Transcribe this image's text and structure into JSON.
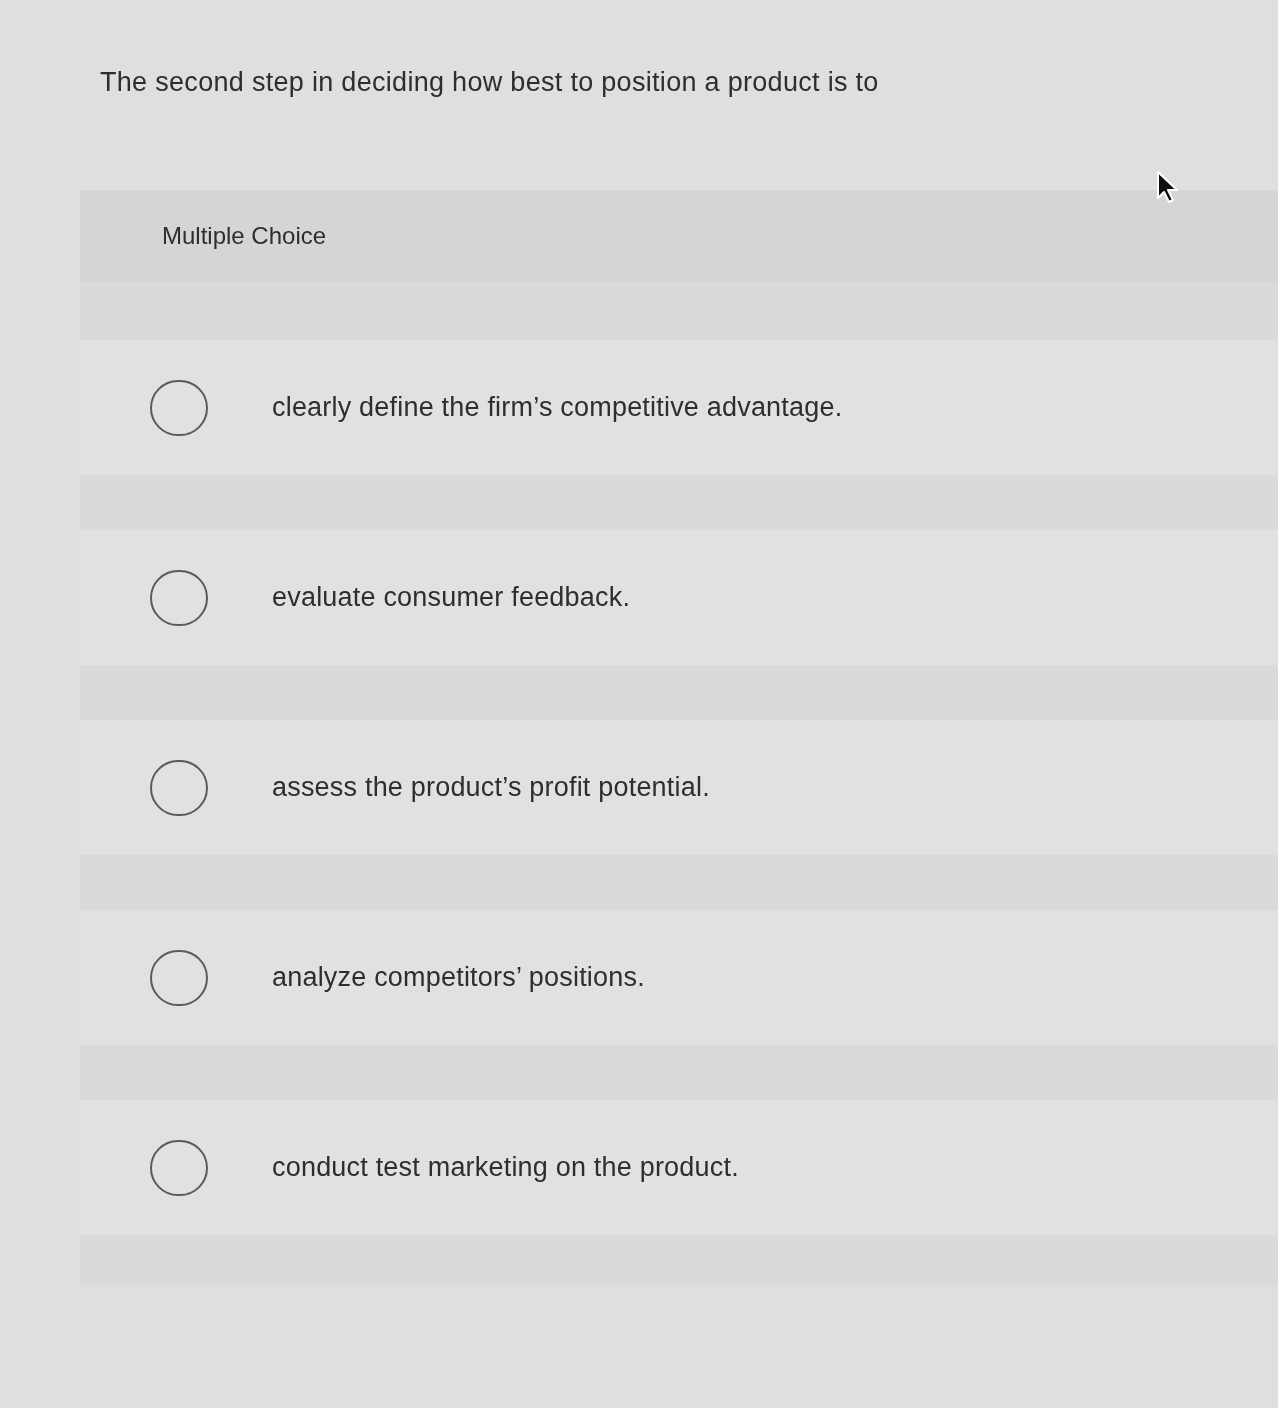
{
  "question": {
    "text": "The second step in deciding how best to position a product is to"
  },
  "answer_panel": {
    "heading": "Multiple Choice",
    "options": [
      {
        "label": "clearly define the firm’s competitive advantage.",
        "selected": false
      },
      {
        "label": "evaluate consumer feedback.",
        "selected": false
      },
      {
        "label": "assess the product’s profit potential.",
        "selected": false
      },
      {
        "label": "analyze competitors’ positions.",
        "selected": false
      },
      {
        "label": "conduct test marketing on the product.",
        "selected": false
      }
    ]
  }
}
